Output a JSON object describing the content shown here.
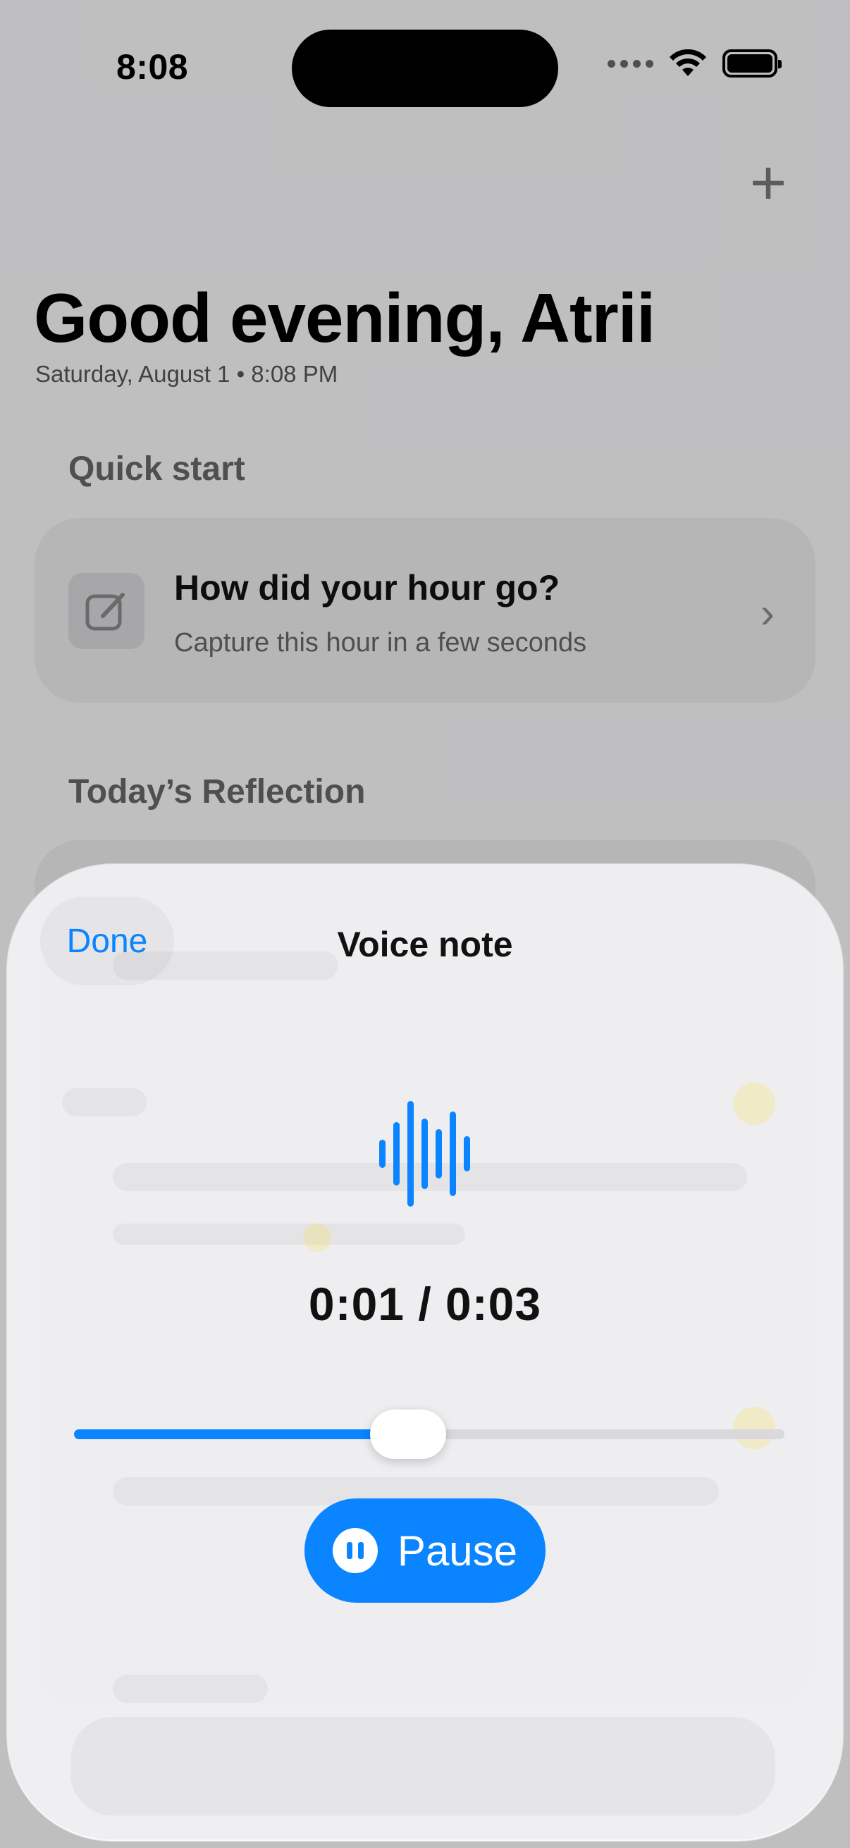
{
  "status": {
    "time": "8:08"
  },
  "header": {
    "greeting": "Good evening, Atrii",
    "date_line": "Saturday, August 1 • 8:08 PM",
    "add_icon": "plus-icon"
  },
  "quick_start": {
    "section_title": "Quick start",
    "card": {
      "icon": "compose-icon",
      "title": "How did your hour go?",
      "subtitle": "Capture this hour in a few seconds"
    }
  },
  "reflection": {
    "section_title": "Today’s Reflection"
  },
  "sheet": {
    "done_label": "Done",
    "title": "Voice note",
    "icon": "waveform-icon",
    "timer": "0:01 / 0:03",
    "playback_progress": 0.47,
    "pause_label": "Pause",
    "accent_color": "#0a84ff"
  }
}
